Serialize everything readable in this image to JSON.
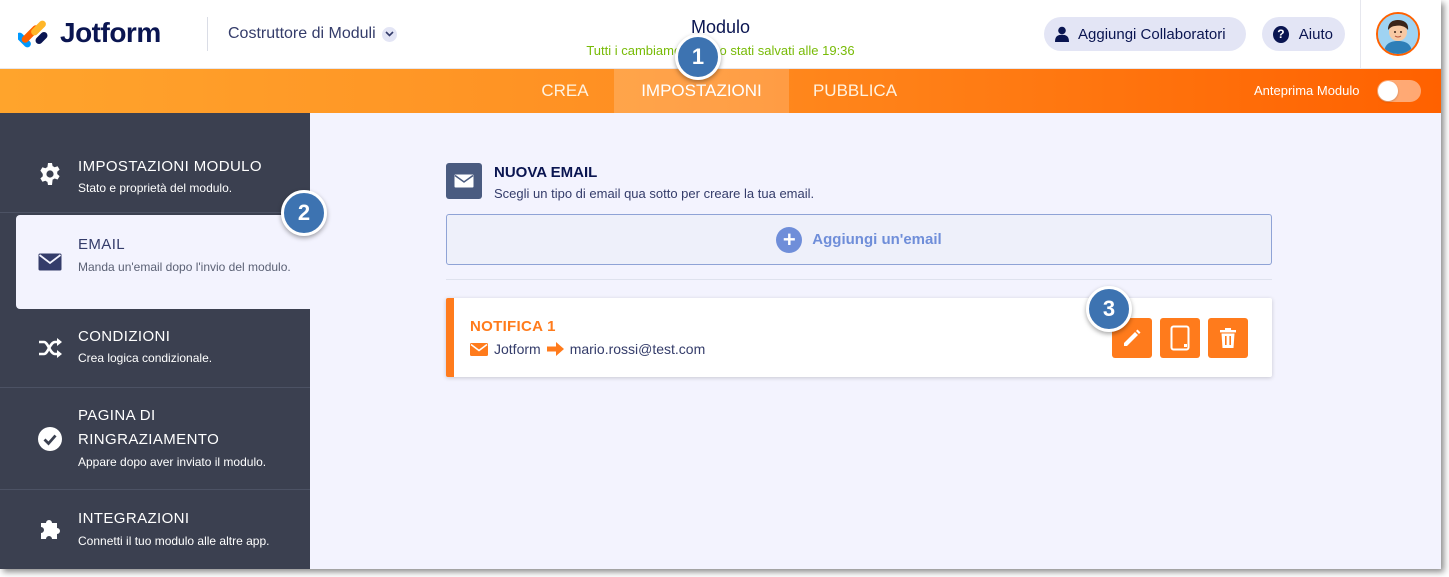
{
  "header": {
    "logo_text": "Jotform",
    "builder_label": "Costruttore di Moduli",
    "form_title": "Modulo",
    "saved_status": "Tutti i cambiamenti sono stati salvati alle 19:36",
    "collaborators_label": "Aggiungi Collaboratori",
    "help_label": "Aiuto"
  },
  "nav": {
    "tabs": [
      {
        "label": "CREA"
      },
      {
        "label": "IMPOSTAZIONI",
        "active": true
      },
      {
        "label": "PUBBLICA"
      }
    ],
    "preview_label": "Anteprima Modulo",
    "preview_enabled": false
  },
  "sidebar": {
    "items": [
      {
        "title": "IMPOSTAZIONI MODULO",
        "desc": "Stato e proprietà del modulo.",
        "icon": "gear-icon"
      },
      {
        "title": "EMAIL",
        "desc": "Manda un'email dopo l'invio del modulo.",
        "icon": "envelope-icon",
        "active": true
      },
      {
        "title": "CONDIZIONI",
        "desc": "Crea logica condizionale.",
        "icon": "shuffle-icon"
      },
      {
        "title": "PAGINA DI RINGRAZIAMENTO",
        "desc": "Appare dopo aver inviato il modulo.",
        "icon": "check-circle-icon"
      },
      {
        "title": "INTEGRAZIONI",
        "desc": "Connetti il tuo modulo alle altre app.",
        "icon": "puzzle-icon"
      }
    ]
  },
  "main": {
    "new_email_title": "NUOVA EMAIL",
    "new_email_desc": "Scegli un tipo di email qua sotto per creare la tua email.",
    "add_email_label": "Aggiungi un'email",
    "notification": {
      "title": "NOTIFICA 1",
      "from": "Jotform",
      "to": "mario.rossi@test.com"
    }
  },
  "markers": [
    "1",
    "2",
    "3"
  ],
  "colors": {
    "accent_orange": "#ff7b1c",
    "navy": "#0a1551",
    "sidebar_bg": "#3b4050",
    "saved_green": "#78bb07",
    "marker_blue": "#3d73b1"
  }
}
